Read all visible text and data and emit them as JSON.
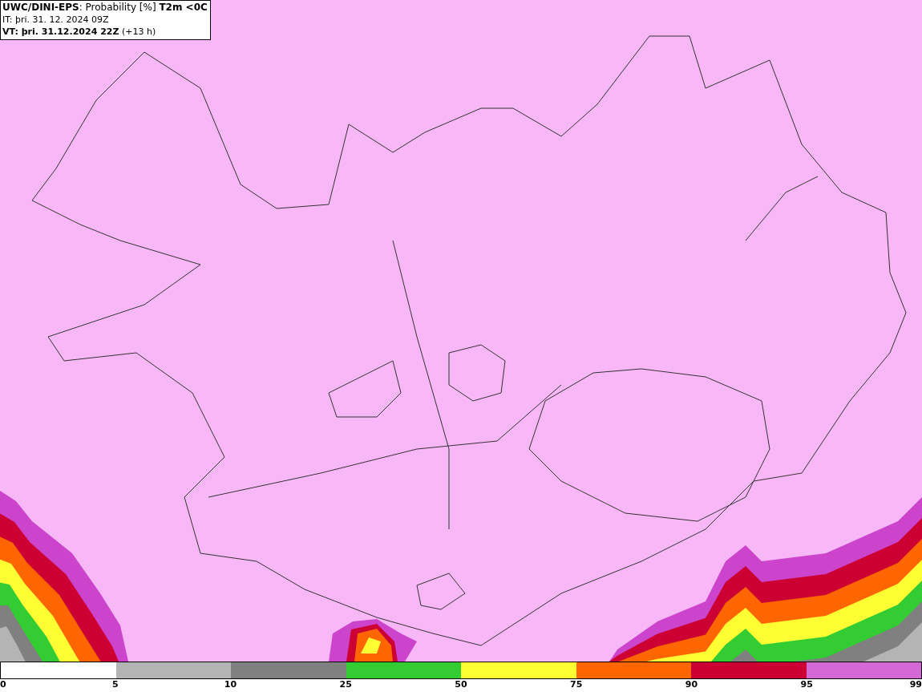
{
  "header": {
    "title": "**UWC/DINI-EPS**: Probability [%] **T2m <0C**",
    "issue_time": "IT: þri. 31. 12. 2024 09Z",
    "valid_time": "**VT: þri. 31.12.2024 22Z** (+13 h)"
  },
  "legend": {
    "segments": [
      {
        "color": "#ffffff"
      },
      {
        "color": "#b4b4b4"
      },
      {
        "color": "#808080"
      },
      {
        "color": "#33cc33"
      },
      {
        "color": "#ffff33"
      },
      {
        "color": "#ff6600"
      },
      {
        "color": "#cc0033"
      },
      {
        "color": "#d468d4"
      }
    ],
    "ticks": [
      "0",
      "5",
      "10",
      "25",
      "50",
      "75",
      "90",
      "95",
      "99"
    ]
  }
}
